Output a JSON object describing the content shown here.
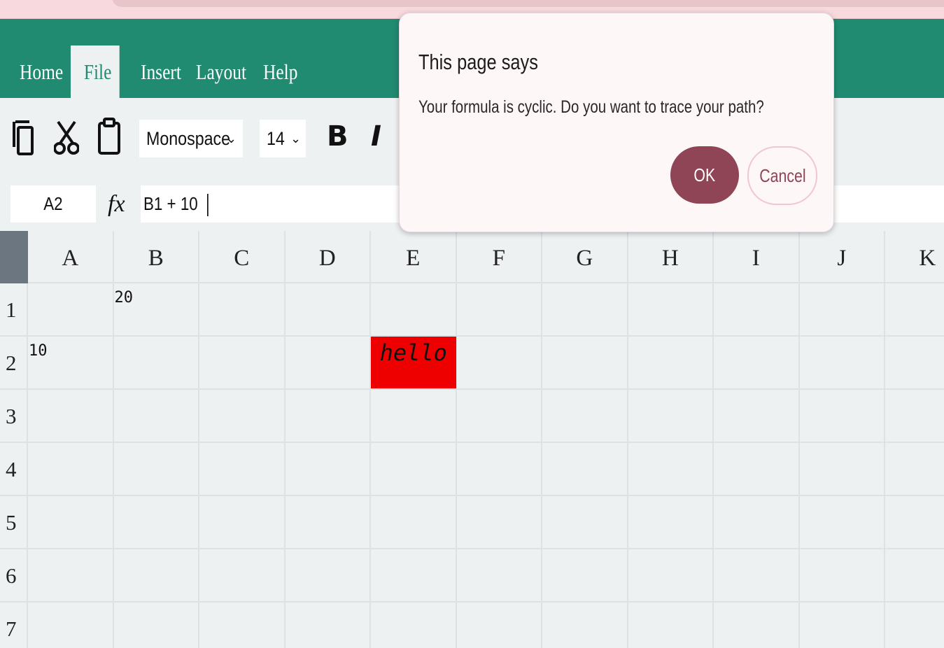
{
  "menu": {
    "items": [
      {
        "label": "Home"
      },
      {
        "label": "File",
        "active": true
      },
      {
        "label": "Insert"
      },
      {
        "label": "Layout"
      },
      {
        "label": "Help"
      }
    ]
  },
  "toolbar": {
    "font_family": "Monospace",
    "font_size": "14",
    "bold_label": "B",
    "italic_label": "I",
    "icons": [
      "copy-icon",
      "cut-icon",
      "paste-icon"
    ]
  },
  "formula_bar": {
    "cell_ref": "A2",
    "fx_label": "fx",
    "formula": "B1 + 10"
  },
  "sheet": {
    "columns": [
      "A",
      "B",
      "C",
      "D",
      "E",
      "F",
      "G",
      "H",
      "I",
      "J",
      "K"
    ],
    "rows": [
      "1",
      "2",
      "3",
      "4",
      "5",
      "6",
      "7"
    ],
    "cells": {
      "B1": "20",
      "A2": "10",
      "E2": "hello"
    },
    "highlight_color": "#ee0000"
  },
  "dialog": {
    "title": "This page says",
    "message": "Your formula is cyclic. Do you want to trace your path?",
    "ok_label": "OK",
    "cancel_label": "Cancel"
  },
  "colors": {
    "menubar": "#208b71",
    "ok_button": "#8f4555"
  }
}
